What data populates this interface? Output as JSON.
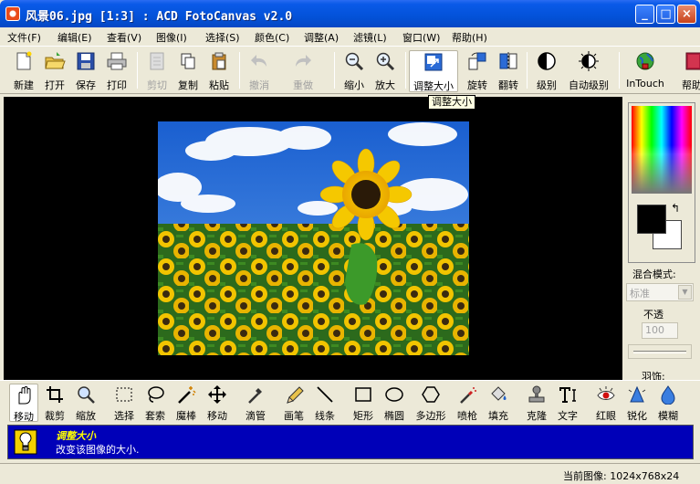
{
  "window": {
    "title": "风景06.jpg [1:3] : ACD FotoCanvas v2.0",
    "minimize_label": "_",
    "maximize_label": "□",
    "close_label": "×"
  },
  "menu": [
    "文件(F)",
    "编辑(E)",
    "查看(V)",
    "图像(I)",
    "选择(S)",
    "颜色(C)",
    "调整(A)",
    "滤镜(L)",
    "窗口(W)",
    "帮助(H)"
  ],
  "toolbar": {
    "new": "新建",
    "open": "打开",
    "save": "保存",
    "print": "打印",
    "cut": "剪切",
    "copy": "复制",
    "paste": "粘贴",
    "undo": "撤消",
    "redo": "重做",
    "zoom_out": "缩小",
    "zoom_in": "放大",
    "resize": "调整大小",
    "rotate": "旋转",
    "flip": "翻转",
    "levels": "级别",
    "auto_levels": "自动级别",
    "intouch": "InTouch",
    "help": "帮助"
  },
  "tooltip": "调整大小",
  "panel": {
    "blend_mode_label": "混合模式:",
    "blend_mode_value": "标准",
    "opacity_label": "不透",
    "opacity_value": "100",
    "feather_label": "羽饰:",
    "swap_symbol": "↰"
  },
  "tools": {
    "move_hand": "移动",
    "crop": "裁剪",
    "zoom": "缩放",
    "select": "选择",
    "lasso": "套索",
    "magic_wand": "魔棒",
    "move": "移动",
    "eyedropper": "滴管",
    "brush": "画笔",
    "line": "线条",
    "rect": "矩形",
    "ellipse": "椭圆",
    "polygon": "多边形",
    "airbrush": "喷枪",
    "fill": "填充",
    "clone": "克隆",
    "text": "文字",
    "redeye": "红眼",
    "sharpen": "锐化",
    "blur": "模糊"
  },
  "info": {
    "title": "调整大小",
    "description": "改变该图像的大小."
  },
  "status": {
    "current_image": "当前图像:   1024x768x24"
  },
  "colors": {
    "title_bar": "#0352d9",
    "canvas": "#000000",
    "info_bar": "#0000b8",
    "info_title": "#ffff00"
  }
}
